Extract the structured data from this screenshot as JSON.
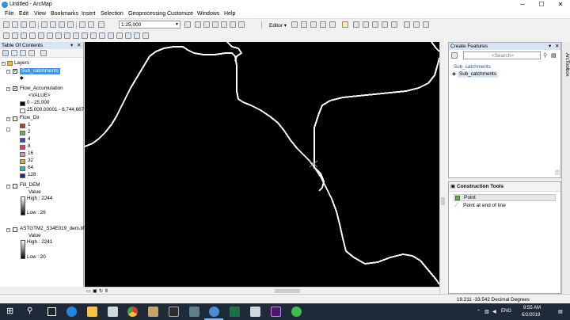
{
  "window": {
    "title": "Untitled - ArcMap",
    "minimize": "─",
    "maximize": "☐",
    "close": "✕"
  },
  "menu": [
    "File",
    "Edit",
    "View",
    "Bookmarks",
    "Insert",
    "Selection",
    "Geoprocessing",
    "Customize",
    "Windows",
    "Help"
  ],
  "toolbar": {
    "scale": "1:25,000",
    "editor_label": "Editor ▾"
  },
  "toc": {
    "title": "Table Of Contents",
    "root_label": "Layers",
    "layers": [
      {
        "name": "Sub_catchments",
        "checked": true,
        "selected": true
      },
      {
        "name": "Flow_Accumulation",
        "checked": true,
        "value_label": "<VALUE>",
        "classes": [
          {
            "label": "0 - 25,000",
            "color": "#000000"
          },
          {
            "label": "25,000.00001 - 6,744,667",
            "color": "#ffffff"
          }
        ]
      },
      {
        "name": "Flow_Dir",
        "checked": false,
        "classes": [
          {
            "label": "1",
            "color": "#c0392b"
          },
          {
            "label": "2",
            "color": "#6ab04c"
          },
          {
            "label": "4",
            "color": "#2e4bc6"
          },
          {
            "label": "8",
            "color": "#d33a8e"
          },
          {
            "label": "16",
            "color": "#e88a9a"
          },
          {
            "label": "32",
            "color": "#d6a72b"
          },
          {
            "label": "64",
            "color": "#27b6c8"
          },
          {
            "label": "128",
            "color": "#1d2a8a"
          }
        ]
      },
      {
        "name": "Fill_DEM",
        "checked": false,
        "value_label": "Value",
        "high": "High : 2244",
        "low": "Low : 26"
      },
      {
        "name": "ASTGTM2_S34E019_dem.tif",
        "checked": false,
        "value_label": "Value",
        "high": "High : 2241",
        "low": "Low : 20"
      }
    ]
  },
  "create_features": {
    "title": "Create Features",
    "search_placeholder": "<Search>",
    "group_label": "Sub_catchments",
    "item_label": "Sub_catchments"
  },
  "construction_tools": {
    "title": "Construction Tools",
    "items": [
      "Point",
      "Point at end of line"
    ]
  },
  "arctoolbox_label": "ArcToolbox",
  "status": {
    "coordinates": "19.211  -33.542 Decimal Degrees"
  },
  "taskbar": {
    "time": "9:55 AM",
    "date": "6/2/2019",
    "language": "ENG"
  }
}
